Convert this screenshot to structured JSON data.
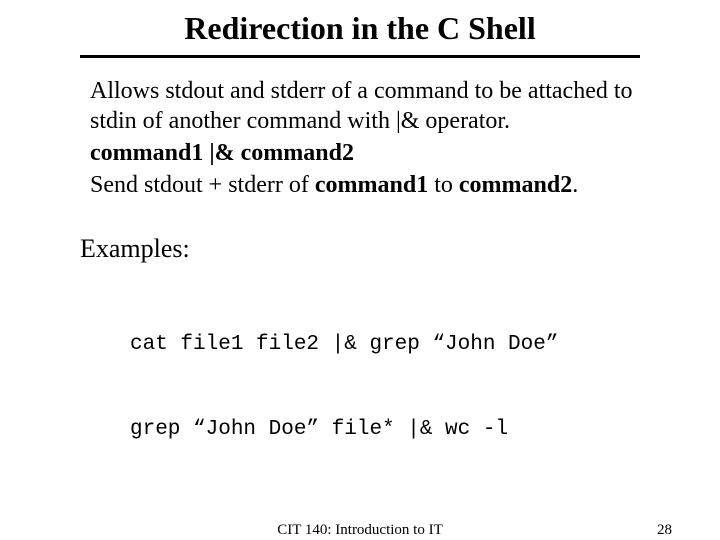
{
  "title": "Redirection in the C Shell",
  "para": {
    "lead": "Allows stdout and stderr of a command to be attached to stdin of another command with |& operator.",
    "syntax_cmd1": "command1",
    "syntax_op": " |& ",
    "syntax_cmd2": "command2",
    "desc_pre": "Send stdout + stderr of ",
    "desc_cmd1": "command1",
    "desc_mid": " to ",
    "desc_cmd2": "command2",
    "desc_post": "."
  },
  "examples_label": "Examples:",
  "examples": [
    "cat file1 file2 |& grep “John Doe”",
    "grep “John Doe” file* |& wc -l"
  ],
  "footer": {
    "course": "CIT 140: Introduction to IT",
    "page": "28"
  }
}
